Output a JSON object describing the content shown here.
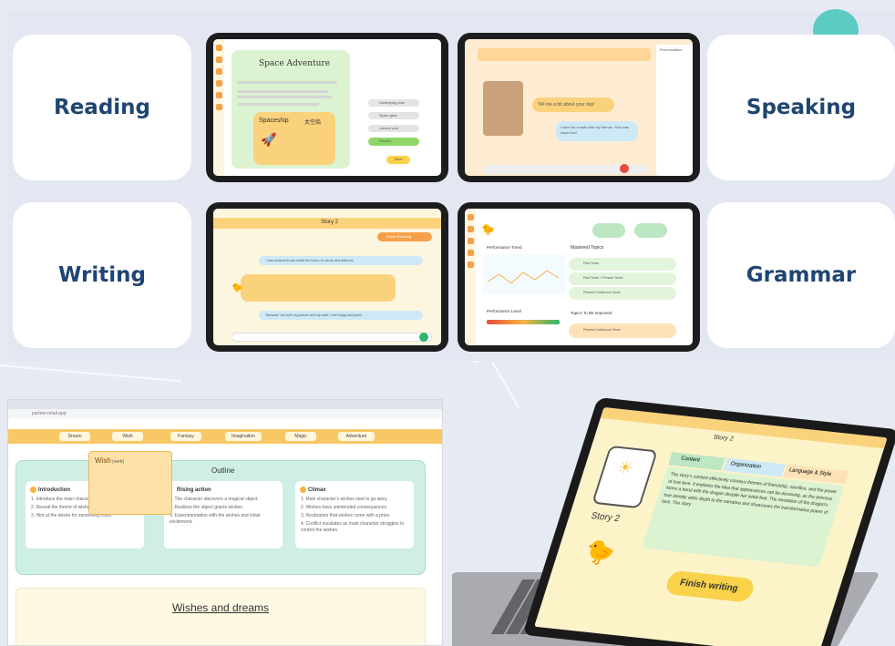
{
  "cards": {
    "reading": "Reading",
    "speaking": "Speaking",
    "writing": "Writing",
    "grammar": "Grammar"
  },
  "reading_app": {
    "title": "Space Adventure",
    "popup_word": "Spaceship",
    "popup_cn": "太空船",
    "answers": [
      "Underlying cost",
      "Spare gear",
      "Launch pad",
      "Planets"
    ],
    "next": "Next"
  },
  "speaking_app": {
    "prompt": "Tell me a bit about your day!",
    "reply": "I went for a walk with my friends. Fido was super fun!",
    "side_title": "Pronunciation"
  },
  "writing_app": {
    "title": "Story 2",
    "bubble1": "I was amazed to see inside the forest, it's whole and delicious.",
    "bubble2": "Because I am with my parents and my sister, I feel happy and joyful.",
    "finish": "Finish Revising"
  },
  "grammar_app": {
    "performance_trend": "Performance Trend",
    "mastered": "Mastered Topics",
    "performance_level": "Performance Level",
    "to_improve": "Topics To Be Improved",
    "topics": [
      "Past Tense",
      "Past Tense + Present Tense",
      "Present Continuous Tense"
    ],
    "improve_topics": [
      "Present Continuous Tense"
    ]
  },
  "browser_app": {
    "url": "partner.retail.app",
    "nav": [
      "Dream",
      "Wish",
      "Fantasy",
      "Imagination",
      "Magic",
      "Adventure"
    ],
    "outline_title": "Outline",
    "popup_word": "Wish",
    "popup_pos": "(verb)",
    "columns": [
      {
        "title": "Introduction",
        "lines": [
          "1. Introduce the main character and the setting.",
          "2. Reveal the theme of wishes and dreams.",
          "3. Hint at the desire for something more."
        ]
      },
      {
        "title": "Rising action",
        "lines": [
          "1. The character discovers a magical object.",
          "2. Realizes the object grants wishes.",
          "3. Experimentation with the wishes and initial excitement."
        ]
      },
      {
        "title": "Climax",
        "lines": [
          "1. Main character's wishes start to go awry.",
          "2. Wishes have unintended consequences.",
          "3. Realization that wishes come with a price.",
          "4. Conflict escalates as main character struggles to control the wishes."
        ]
      }
    ],
    "essay_title": "Wishes and dreams"
  },
  "laptop_app": {
    "title": "Story 2",
    "story_label": "Story 2",
    "tabs": [
      "Content",
      "Organization",
      "Language & Style"
    ],
    "feedback": "The story's content effectively conveys themes of friendship, sacrifice, and the power of true love. It explores the idea that appearances can be deceiving, as the princess forms a bond with the dragon despite her initial fear. The revelation of the dragon's true identity adds depth to the narrative and showcases the transformative power of love. The story",
    "finish": "Finish writing"
  }
}
